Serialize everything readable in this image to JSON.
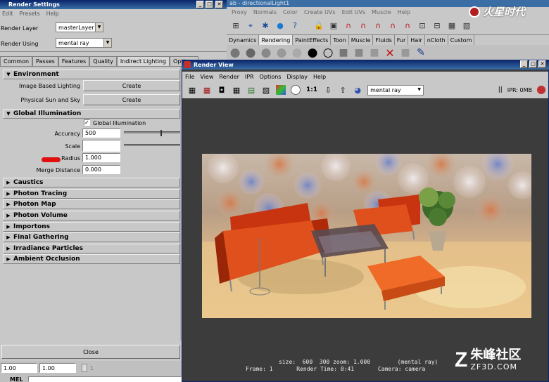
{
  "render_settings": {
    "title": "Render Settings",
    "menu": [
      "Edit",
      "Presets",
      "Help"
    ],
    "render_layer_label": "Render Layer",
    "render_layer_value": "masterLayer",
    "render_using_label": "Render Using",
    "render_using_value": "mental ray",
    "tabs": [
      "Common",
      "Passes",
      "Features",
      "Quality",
      "Indirect Lighting",
      "Options"
    ],
    "environment": {
      "title": "Environment",
      "ibl_label": "Image Based Lighting",
      "ibl_button": "Create",
      "sun_label": "Physical Sun and Sky",
      "sun_button": "Create"
    },
    "gi": {
      "title": "Global Illumination",
      "checkbox_label": "Global Illumination",
      "accuracy_label": "Accuracy",
      "accuracy_value": "500",
      "scale_label": "Scale",
      "radius_label": "Radius",
      "radius_value": "1.000",
      "merge_label": "Merge Distance",
      "merge_value": "0.000"
    },
    "sections": [
      "Caustics",
      "Photon Tracing",
      "Photon Map",
      "Photon Volume",
      "Importons",
      "Final Gathering",
      "Irradiance Particles",
      "Ambient Occlusion"
    ],
    "close_button": "Close",
    "bottom_field_1": "1.00",
    "bottom_field_2": "1.00",
    "bottom_field_3": "1",
    "bottom_mel": "MEL"
  },
  "maya_main": {
    "title_fragment": "ab  -  directionalLight1",
    "menu": [
      "Proxy",
      "Normals",
      "Color",
      "Create UVs",
      "Edit UVs",
      "Muscle",
      "Help"
    ],
    "shelf_tabs": [
      "Dynamics",
      "Rendering",
      "PaintEffects",
      "Toon",
      "Muscle",
      "Fluids",
      "Fur",
      "Hair",
      "nCloth",
      "Custom"
    ],
    "active_shelf": "Rendering"
  },
  "render_view": {
    "title": "Render View",
    "menu": [
      "File",
      "View",
      "Render",
      "IPR",
      "Options",
      "Display",
      "Help"
    ],
    "ratio": "1:1",
    "renderer": "mental ray",
    "ipr_status": "IPR: 0MB",
    "stats_line1": "size:  600  300 zoom: 1.000        (mental ray)",
    "stats_line2": "Frame: 1       Render Time: 0:41       Camera: camera"
  },
  "watermark_top": "火星时代",
  "watermark_bottom_cn": "朱峰社区",
  "watermark_bottom_url": "ZF3D.COM",
  "colors": {
    "titlebar": "#0a246a",
    "panel": "#c8c8c8",
    "render_bg": "#3c3c3c",
    "annotation_red": "#e01010"
  }
}
